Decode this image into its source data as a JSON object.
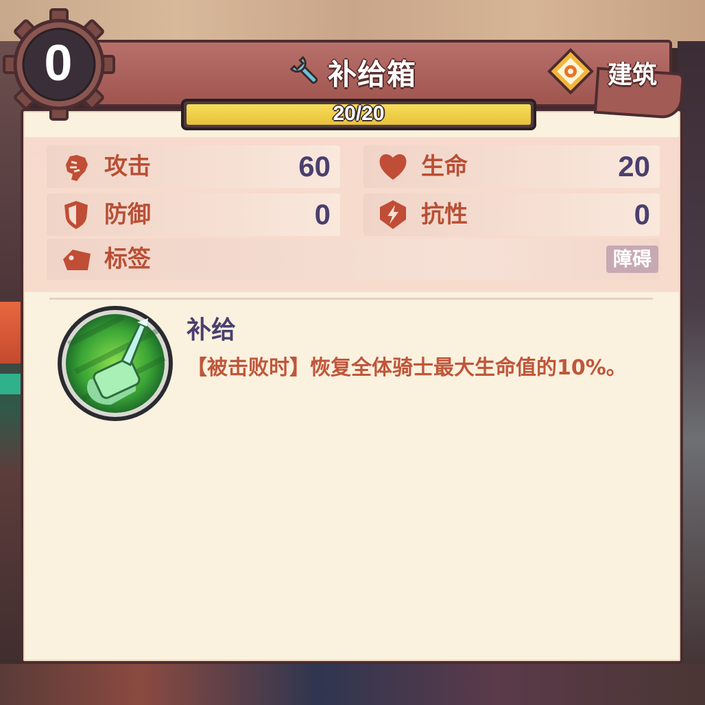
{
  "card": {
    "cost": "0",
    "name": "补给箱",
    "type_label": "建筑",
    "hp_text": "20/20",
    "hp_fraction": 1.0
  },
  "stats": {
    "attack": {
      "label": "攻击",
      "value": "60",
      "icon": "fist-icon"
    },
    "life": {
      "label": "生命",
      "value": "20",
      "icon": "heart-icon"
    },
    "defense": {
      "label": "防御",
      "value": "0",
      "icon": "shield-icon"
    },
    "resistance": {
      "label": "抗性",
      "value": "0",
      "icon": "lightning-shield-icon"
    }
  },
  "tags": {
    "label": "标签",
    "chips": [
      "障碍"
    ]
  },
  "skill": {
    "name": "补给",
    "description": "【被击败时】恢复全体骑士最大生命值的10%。",
    "icon": "supply-potion-icon"
  },
  "colors": {
    "header": "#a0554f",
    "panel": "#fbf1df",
    "label_red": "#b94f35",
    "value_purple": "#4a3f6e",
    "hp_fill": "#e8c13a",
    "skill_green": "#3aa435"
  }
}
